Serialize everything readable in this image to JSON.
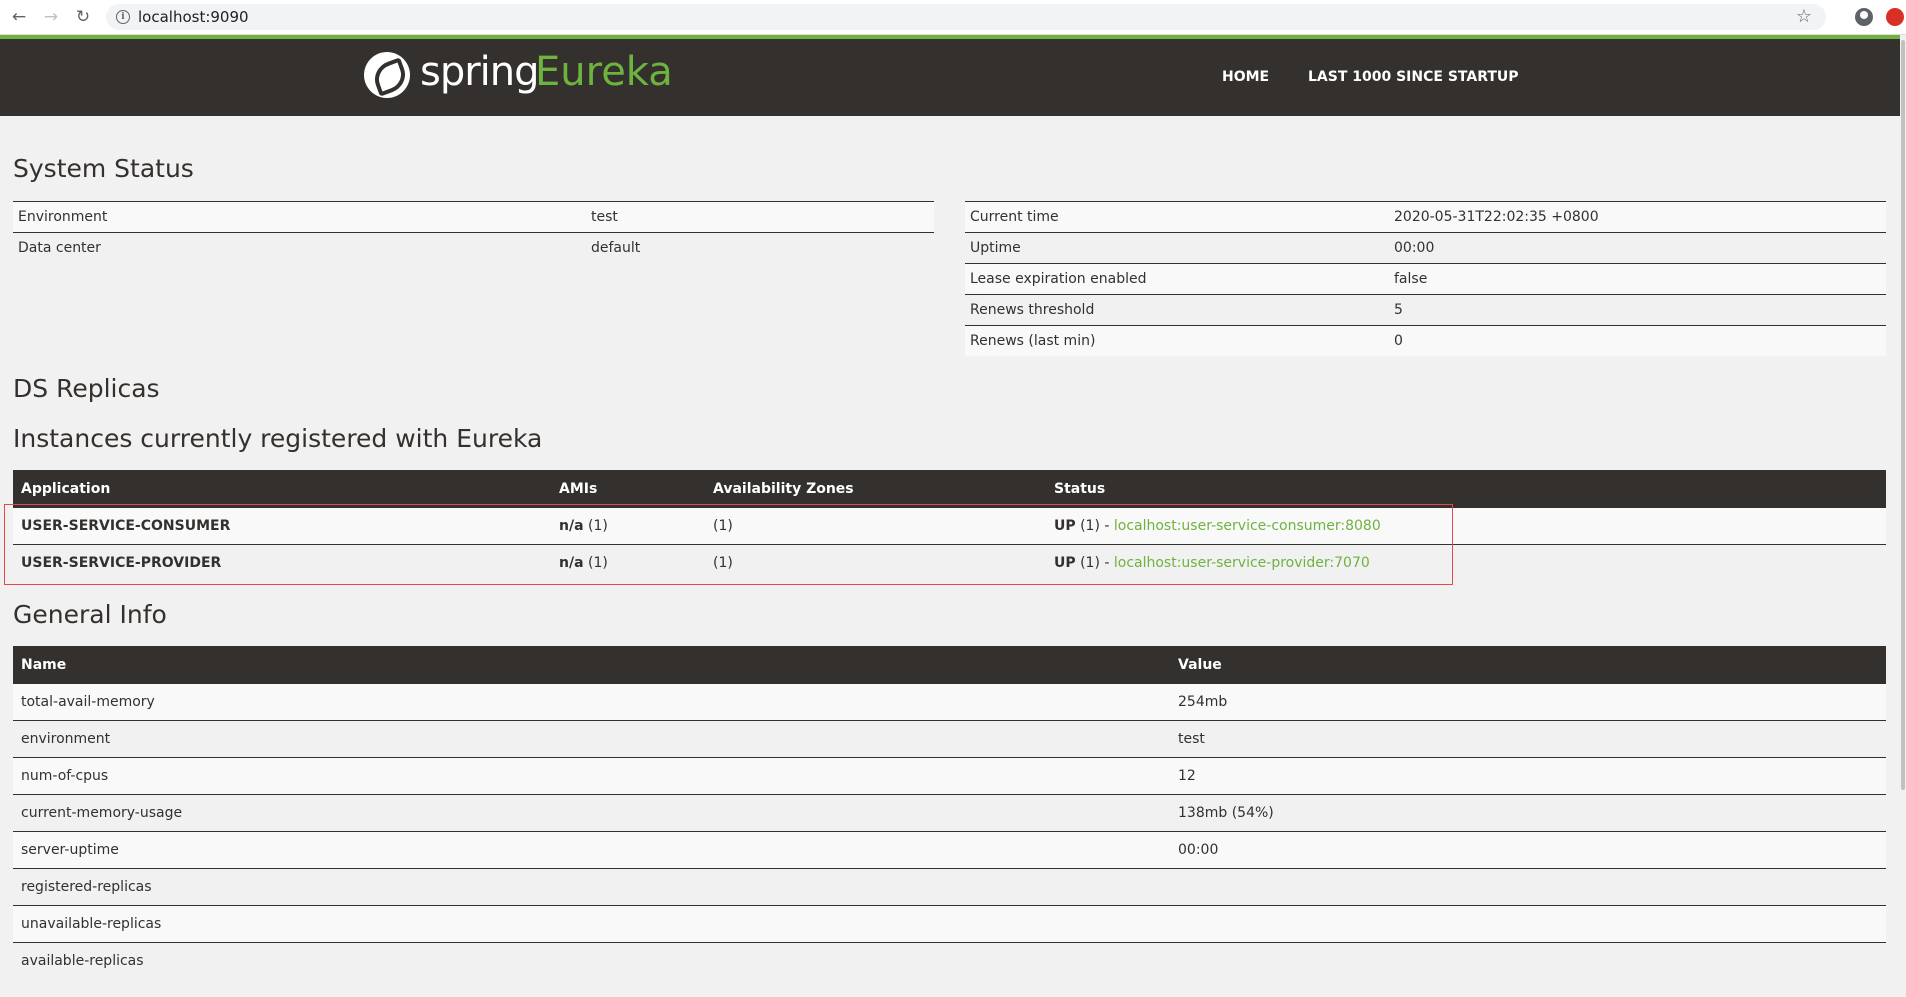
{
  "browser": {
    "url": "localhost:9090",
    "back_icon": "back-arrow-icon",
    "forward_icon": "forward-arrow-icon",
    "reload_icon": "reload-icon"
  },
  "header": {
    "logo_spring": "spring",
    "logo_eureka": "Eureka",
    "nav": [
      "HOME",
      "LAST 1000 SINCE STARTUP"
    ]
  },
  "colors": {
    "brand_green": "#6db33f",
    "header_dark": "#34302d",
    "highlight_red": "#e34b4b"
  },
  "system_status": {
    "title": "System Status",
    "left": [
      {
        "label": "Environment",
        "value": "test"
      },
      {
        "label": "Data center",
        "value": "default"
      }
    ],
    "right": [
      {
        "label": "Current time",
        "value": "2020-05-31T22:02:35 +0800"
      },
      {
        "label": "Uptime",
        "value": "00:00"
      },
      {
        "label": "Lease expiration enabled",
        "value": "false"
      },
      {
        "label": "Renews threshold",
        "value": "5"
      },
      {
        "label": "Renews (last min)",
        "value": "0"
      }
    ]
  },
  "ds_replicas": {
    "title": "DS Replicas"
  },
  "instances": {
    "title": "Instances currently registered with Eureka",
    "headers": [
      "Application",
      "AMIs",
      "Availability Zones",
      "Status"
    ],
    "rows": [
      {
        "application": "USER-SERVICE-CONSUMER",
        "ami_bold": "n/a",
        "ami_count": " (1)",
        "zones": "(1)",
        "status_bold": "UP",
        "status_count": " (1) - ",
        "instance_link": "localhost:user-service-consumer:8080"
      },
      {
        "application": "USER-SERVICE-PROVIDER",
        "ami_bold": "n/a",
        "ami_count": " (1)",
        "zones": "(1)",
        "status_bold": "UP",
        "status_count": " (1) - ",
        "instance_link": "localhost:user-service-provider:7070"
      }
    ]
  },
  "general_info": {
    "title": "General Info",
    "headers": [
      "Name",
      "Value"
    ],
    "rows": [
      {
        "name": "total-avail-memory",
        "value": "254mb"
      },
      {
        "name": "environment",
        "value": "test"
      },
      {
        "name": "num-of-cpus",
        "value": "12"
      },
      {
        "name": "current-memory-usage",
        "value": "138mb (54%)"
      },
      {
        "name": "server-uptime",
        "value": "00:00"
      },
      {
        "name": "registered-replicas",
        "value": ""
      },
      {
        "name": "unavailable-replicas",
        "value": ""
      },
      {
        "name": "available-replicas",
        "value": ""
      }
    ]
  }
}
